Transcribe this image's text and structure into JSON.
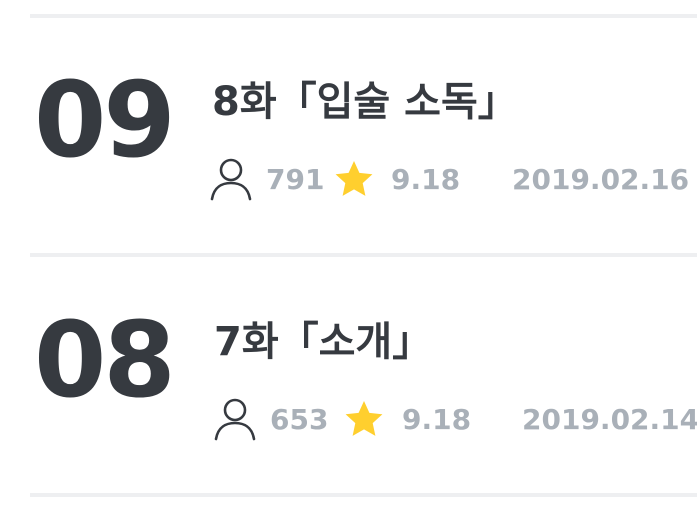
{
  "episodes": [
    {
      "number": "09",
      "title": "8화「입술 소독」",
      "views": "791",
      "rating": "9.18",
      "date": "2019.02.16",
      "icons": {
        "user": "user-icon",
        "star": "star-icon"
      }
    },
    {
      "number": "08",
      "title": "7화「소개」",
      "views": "653",
      "rating": "9.18",
      "date": "2019.02.14",
      "icons": {
        "user": "user-icon",
        "star": "star-icon"
      }
    }
  ],
  "colors": {
    "number": "#363a40",
    "title": "#363a40",
    "meta_text": "#a9b0b8",
    "star": "#ffcf2e",
    "divider": "#eeeff1"
  }
}
